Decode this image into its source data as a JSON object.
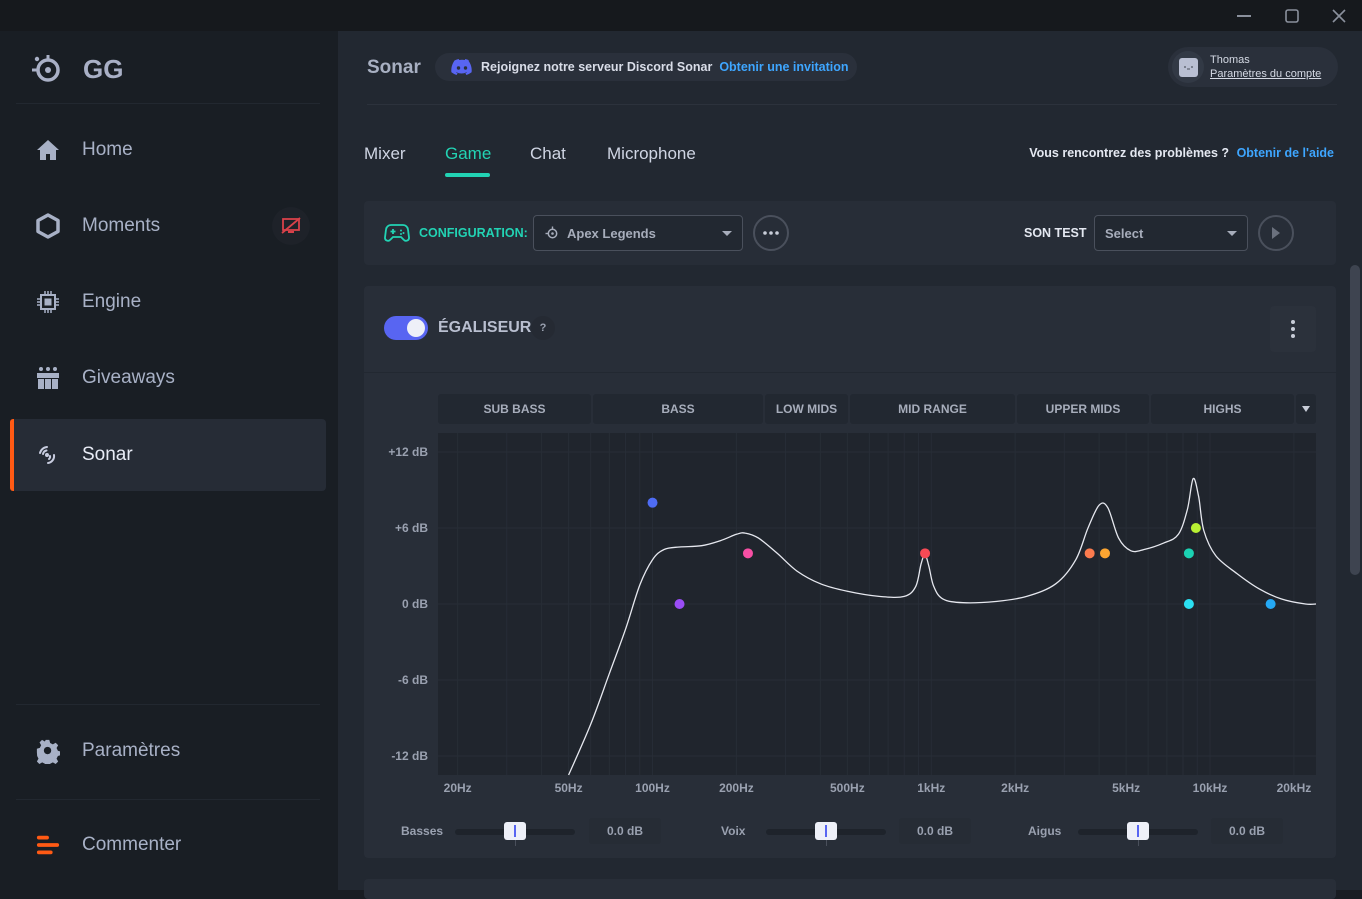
{
  "window": {
    "controls": [
      "minimize",
      "maximize",
      "close"
    ]
  },
  "sidebar": {
    "logo_text": "GG",
    "items": [
      {
        "label": "Home",
        "icon": "home-icon",
        "active": false
      },
      {
        "label": "Moments",
        "icon": "hexagon-icon",
        "active": false,
        "badge": "monitor-off-icon"
      },
      {
        "label": "Engine",
        "icon": "chip-icon",
        "active": false
      },
      {
        "label": "Giveaways",
        "icon": "gift-icon",
        "active": false
      },
      {
        "label": "Sonar",
        "icon": "sonar-icon",
        "active": true
      }
    ],
    "bottom_items": [
      {
        "label": "Paramètres",
        "icon": "gear-icon"
      },
      {
        "label": "Commenter",
        "icon": "feedback-icon"
      }
    ],
    "active_accent": "#ff5a14"
  },
  "header": {
    "title": "Sonar",
    "discord": {
      "text": "Rejoignez notre serveur Discord Sonar",
      "link": "Obtenir une invitation"
    },
    "account": {
      "name": "Thomas",
      "link": "Paramètres du compte"
    }
  },
  "tabs": [
    {
      "label": "Mixer",
      "active": false
    },
    {
      "label": "Game",
      "active": true
    },
    {
      "label": "Chat",
      "active": false
    },
    {
      "label": "Microphone",
      "active": false
    }
  ],
  "help": {
    "question": "Vous rencontrez des problèmes ?",
    "link": "Obtenir de l'aide"
  },
  "config": {
    "label": "CONFIGURATION:",
    "selected": "Apex Legends",
    "more_icon": "ellipsis-icon",
    "son_test_label": "SON TEST",
    "son_test_select": "Select",
    "play_icon": "play-icon"
  },
  "equalizer": {
    "enabled": true,
    "title": "ÉGALISEUR",
    "help": "?",
    "bands": [
      "SUB BASS",
      "BASS",
      "LOW MIDS",
      "MID RANGE",
      "UPPER MIDS",
      "HIGHS"
    ],
    "sliders": [
      {
        "label": "Basses",
        "value": "0.0 dB",
        "position": 0.5
      },
      {
        "label": "Voix",
        "value": "0.0 dB",
        "position": 0.5
      },
      {
        "label": "Aigus",
        "value": "0.0 dB",
        "position": 0.5
      }
    ]
  },
  "chart_data": {
    "type": "line",
    "title": "Égaliseur",
    "xlabel": "",
    "ylabel": "",
    "x_scale": "log",
    "xlim": [
      17,
      24000
    ],
    "ylim": [
      -13.5,
      13.5
    ],
    "x_ticks": [
      {
        "value": 20,
        "label": "20Hz"
      },
      {
        "value": 50,
        "label": "50Hz"
      },
      {
        "value": 100,
        "label": "100Hz"
      },
      {
        "value": 200,
        "label": "200Hz"
      },
      {
        "value": 500,
        "label": "500Hz"
      },
      {
        "value": 1000,
        "label": "1kHz"
      },
      {
        "value": 2000,
        "label": "2kHz"
      },
      {
        "value": 5000,
        "label": "5kHz"
      },
      {
        "value": 10000,
        "label": "10kHz"
      },
      {
        "value": 20000,
        "label": "20kHz"
      }
    ],
    "y_ticks": [
      {
        "value": 12,
        "label": "+12 dB"
      },
      {
        "value": 6,
        "label": "+6 dB"
      },
      {
        "value": 0,
        "label": "0 dB"
      },
      {
        "value": -6,
        "label": "-6 dB"
      },
      {
        "value": -12,
        "label": "-12 dB"
      }
    ],
    "grid": true,
    "curve": {
      "color": "#e6e8ef",
      "points": [
        [
          50,
          -13.5
        ],
        [
          60,
          -9.5
        ],
        [
          70,
          -5.5
        ],
        [
          80,
          -2
        ],
        [
          90,
          1.5
        ],
        [
          100,
          3.5
        ],
        [
          110,
          4.3
        ],
        [
          125,
          4.5
        ],
        [
          150,
          4.6
        ],
        [
          175,
          5.0
        ],
        [
          200,
          5.5
        ],
        [
          215,
          5.6
        ],
        [
          240,
          5.2
        ],
        [
          280,
          4.0
        ],
        [
          330,
          2.6
        ],
        [
          400,
          1.6
        ],
        [
          500,
          1.0
        ],
        [
          650,
          0.6
        ],
        [
          800,
          0.6
        ],
        [
          880,
          1.4
        ],
        [
          920,
          3.2
        ],
        [
          950,
          3.9
        ],
        [
          980,
          3.0
        ],
        [
          1020,
          1.4
        ],
        [
          1100,
          0.4
        ],
        [
          1300,
          0.1
        ],
        [
          1700,
          0.2
        ],
        [
          2200,
          0.6
        ],
        [
          2800,
          1.6
        ],
        [
          3300,
          3.5
        ],
        [
          3650,
          6.0
        ],
        [
          4000,
          7.8
        ],
        [
          4300,
          7.6
        ],
        [
          4700,
          5.2
        ],
        [
          5200,
          4.2
        ],
        [
          5800,
          4.3
        ],
        [
          6800,
          4.8
        ],
        [
          7700,
          5.5
        ],
        [
          8300,
          7.5
        ],
        [
          8700,
          9.9
        ],
        [
          9100,
          8.5
        ],
        [
          9500,
          5.8
        ],
        [
          10500,
          3.8
        ],
        [
          12500,
          2.4
        ],
        [
          15000,
          1.2
        ],
        [
          18000,
          0.4
        ],
        [
          22000,
          0.0
        ],
        [
          24000,
          0.0
        ]
      ]
    },
    "nodes": [
      {
        "freq": 100,
        "gain": 8,
        "color": "#4e6cf4"
      },
      {
        "freq": 125,
        "gain": 0,
        "color": "#9a4df6"
      },
      {
        "freq": 220,
        "gain": 4,
        "color": "#f74fa4"
      },
      {
        "freq": 950,
        "gain": 4,
        "color": "#f74a55"
      },
      {
        "freq": 3700,
        "gain": 4,
        "color": "#fb7b4e"
      },
      {
        "freq": 4200,
        "gain": 4,
        "color": "#fca531"
      },
      {
        "freq": 8400,
        "gain": 4,
        "color": "#1bd2b3"
      },
      {
        "freq": 8900,
        "gain": 6,
        "color": "#b8f033"
      },
      {
        "freq": 8400,
        "gain": 0,
        "color": "#2be0f2"
      },
      {
        "freq": 16500,
        "gain": 0,
        "color": "#25a9f4"
      }
    ]
  }
}
